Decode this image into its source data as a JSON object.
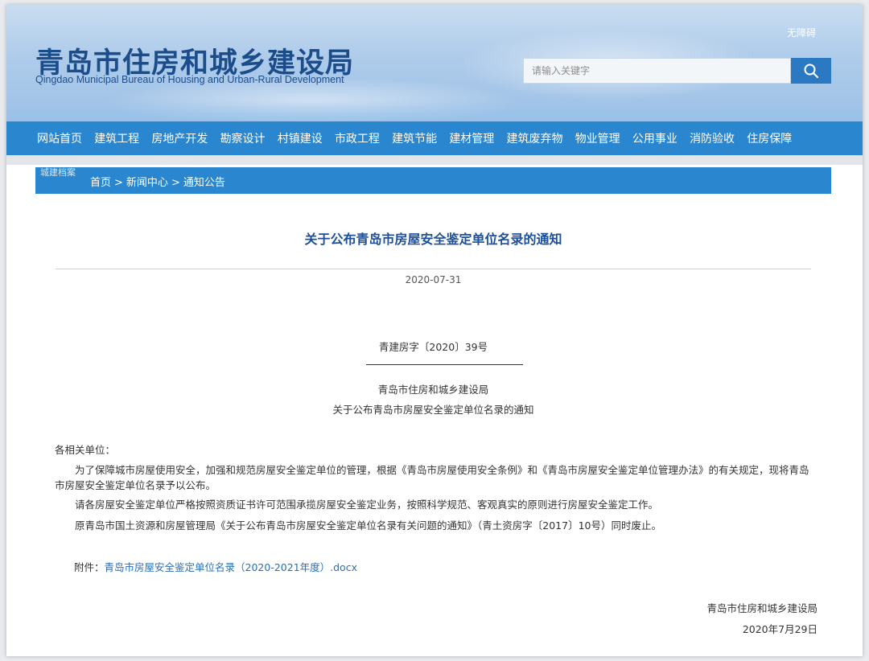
{
  "header": {
    "site_title": "青岛市住房和城乡建设局",
    "site_subtitle": "Qingdao Municipal Bureau of Housing and Urban-Rural Development",
    "accessibility_link": "无障碍",
    "search_placeholder": "请输入关键字"
  },
  "nav": {
    "items": [
      "网站首页",
      "建筑工程",
      "房地产开发",
      "勘察设计",
      "村镇建设",
      "市政工程",
      "建筑节能",
      "建材管理",
      "建筑废弃物",
      "物业管理",
      "公用事业",
      "消防验收",
      "住房保障"
    ]
  },
  "breadcrumb": {
    "tag": "城建档案",
    "items": [
      "首页",
      "新闻中心",
      "通知公告"
    ],
    "separator": ">"
  },
  "article": {
    "title": "关于公布青岛市房屋安全鉴定单位名录的通知",
    "publish_date": "2020-07-31",
    "doc_number": "青建房字〔2020〕39号",
    "issuer": "青岛市住房和城乡建设局",
    "subject": "关于公布青岛市房屋安全鉴定单位名录的通知",
    "salutation": "各相关单位：",
    "paragraphs": [
      "为了保障城市房屋使用安全，加强和规范房屋安全鉴定单位的管理，根据《青岛市房屋使用安全条例》和《青岛市房屋安全鉴定单位管理办法》的有关规定，现将青岛市房屋安全鉴定单位名录予以公布。",
      "请各房屋安全鉴定单位严格按照资质证书许可范围承揽房屋安全鉴定业务，按照科学规范、客观真实的原则进行房屋安全鉴定工作。",
      "原青岛市国土资源和房屋管理局《关于公布青岛市房屋安全鉴定单位名录有关问题的通知》（青土资房字〔2017〕10号）同时废止。"
    ],
    "attachment_label": "附件：",
    "attachment_link": "青岛市房屋安全鉴定单位名录（2020-2021年度）.docx",
    "signature": "青岛市住房和城乡建设局",
    "signature_date": "2020年7月29日"
  },
  "colors": {
    "nav_bg": "#2a86ce",
    "title_color": "#1d4f9a",
    "link_color": "#2a6eb5"
  },
  "icons": {
    "search": "search-icon"
  }
}
